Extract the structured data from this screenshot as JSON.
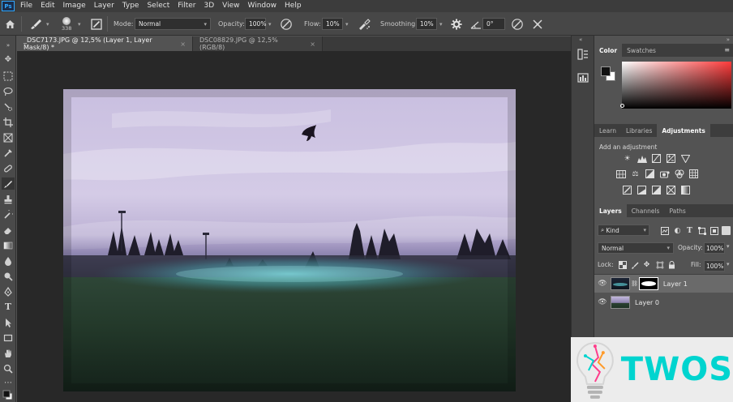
{
  "menu": {
    "logo": "Ps",
    "items": [
      "File",
      "Edit",
      "Image",
      "Layer",
      "Type",
      "Select",
      "Filter",
      "3D",
      "View",
      "Window",
      "Help"
    ]
  },
  "options": {
    "brush_size": "338",
    "mode_label": "Mode:",
    "mode_value": "Normal",
    "opacity_label": "Opacity:",
    "opacity_value": "100%",
    "flow_label": "Flow:",
    "flow_value": "10%",
    "smoothing_label": "Smoothing:",
    "smoothing_value": "10%",
    "angle_value": "0°"
  },
  "tabs": [
    {
      "label": "_DSC7173.JPG @ 12,5% (Layer 1, Layer Mask/8) *",
      "close": "×"
    },
    {
      "label": "DSC08829.JPG @ 12,5% (RGB/8)",
      "close": "×"
    }
  ],
  "color_panel": {
    "tabs": [
      "Color",
      "Swatches"
    ]
  },
  "adjustments_panel": {
    "tabs": [
      "Learn",
      "Libraries",
      "Adjustments"
    ],
    "heading": "Add an adjustment"
  },
  "layers_panel": {
    "tabs": [
      "Layers",
      "Channels",
      "Paths"
    ],
    "kind_label": "Kind",
    "blend_mode": "Normal",
    "opacity_label": "Opacity:",
    "opacity_value": "100%",
    "lock_label": "Lock:",
    "fill_label": "Fill:",
    "fill_value": "100%",
    "layers": [
      {
        "name": "Layer 1"
      },
      {
        "name": "Layer 0"
      }
    ]
  },
  "watermark": {
    "text": "TWOS"
  },
  "colors": {
    "accent": "#31a8ff",
    "panel": "#535353",
    "canvas_bg": "#282828",
    "watermark_text": "#00d4cf"
  }
}
